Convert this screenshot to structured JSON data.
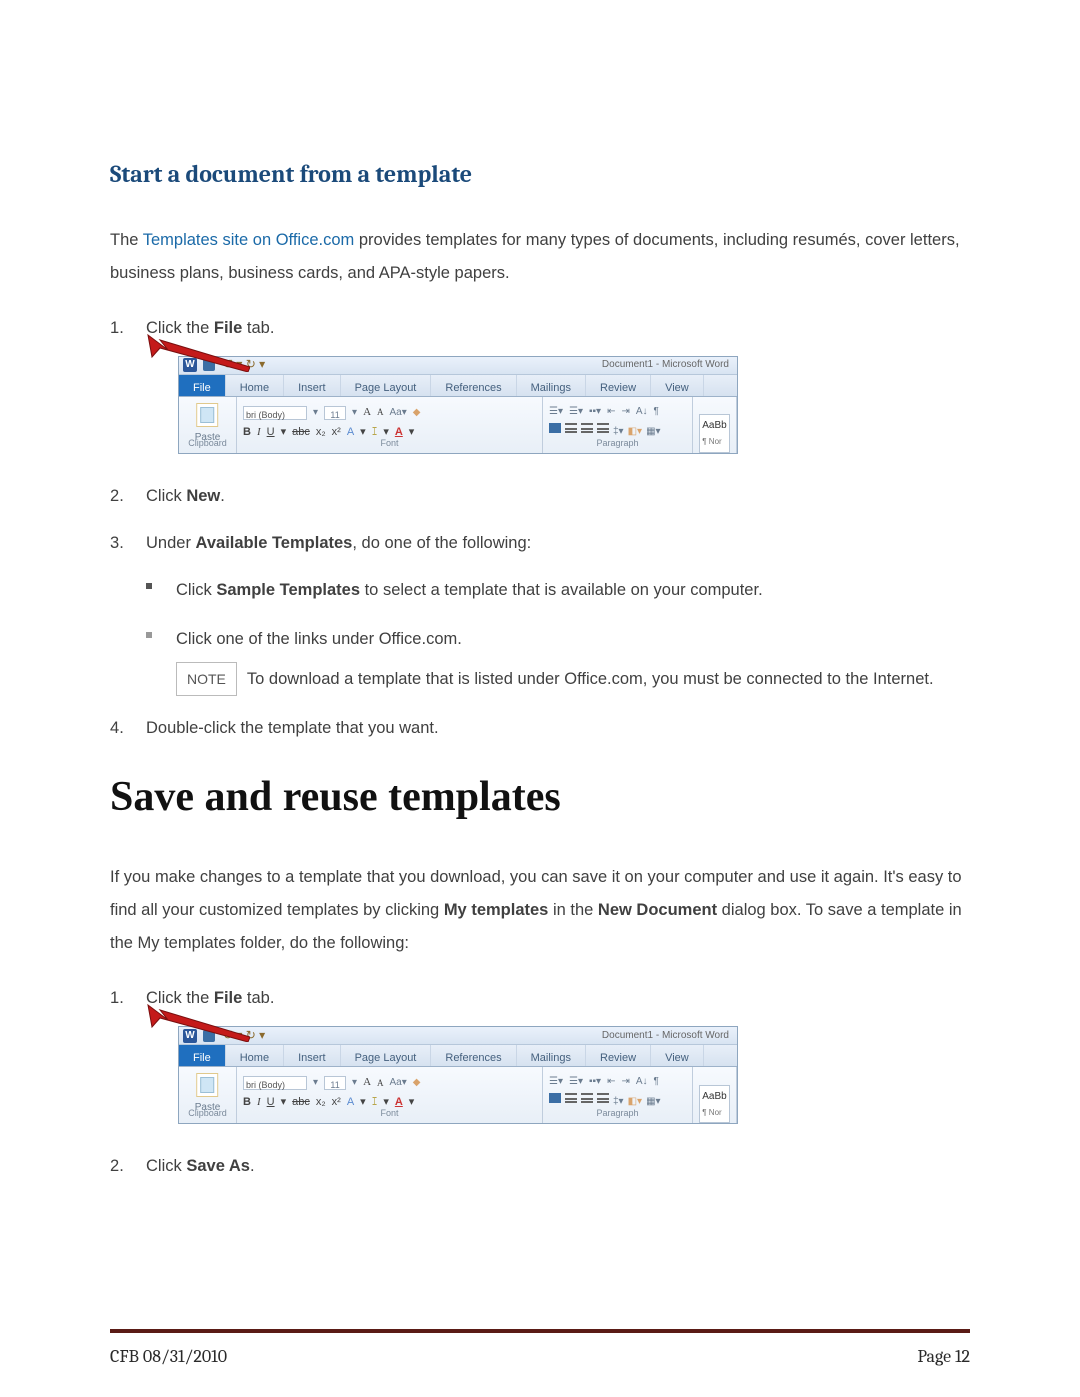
{
  "heading1": "Start a document from a template",
  "intro_pre": "The ",
  "intro_link": "Templates site on Office.com",
  "intro_post": " provides templates for many types of documents, including resumés, cover letters, business plans, business cards, and APA-style papers.",
  "stepsA": {
    "s1_pre": "Click the ",
    "s1_b": "File",
    "s1_post": " tab.",
    "s2_pre": "Click ",
    "s2_b": "New",
    "s2_post": ".",
    "s3_pre": "Under ",
    "s3_b": "Available Templates",
    "s3_post": ", do one of the following:",
    "b1_pre": "Click ",
    "b1_b": "Sample Templates",
    "b1_post": " to select a template that is available on your computer.",
    "b2": "Click one of the links under Office.com.",
    "note_label": "NOTE",
    "note_text": "To download a template that is listed under Office.com, you must be connected to the Internet.",
    "s4": "Double-click the template that you want."
  },
  "heading2": "Save and reuse templates",
  "para2_pre": "If you make changes to a template that you download, you can save it on your computer and use it again. It's easy to find all your customized templates by clicking ",
  "para2_b1": "My templates",
  "para2_mid": " in the ",
  "para2_b2": "New Document",
  "para2_post": " dialog box. To save a template in the My templates folder, do the following:",
  "stepsB": {
    "s1_pre": "Click the ",
    "s1_b": "File",
    "s1_post": " tab.",
    "s2_pre": "Click ",
    "s2_b": "Save As",
    "s2_post": "."
  },
  "ribbon": {
    "doctitle": "Document1 - Microsoft Word",
    "tabs": [
      "File",
      "Home",
      "Insert",
      "Page Layout",
      "References",
      "Mailings",
      "Review",
      "View"
    ],
    "clipboard_paste": "Paste",
    "clipboard_label": "Clipboard",
    "font_family": "bri (Body)",
    "font_size": "11",
    "font_label": "Font",
    "para_label": "Paragraph",
    "style_sample": "AaBb",
    "style_sub": "¶ Nor"
  },
  "footer_left": "CFB 08/31/2010",
  "footer_right": "Page 12"
}
